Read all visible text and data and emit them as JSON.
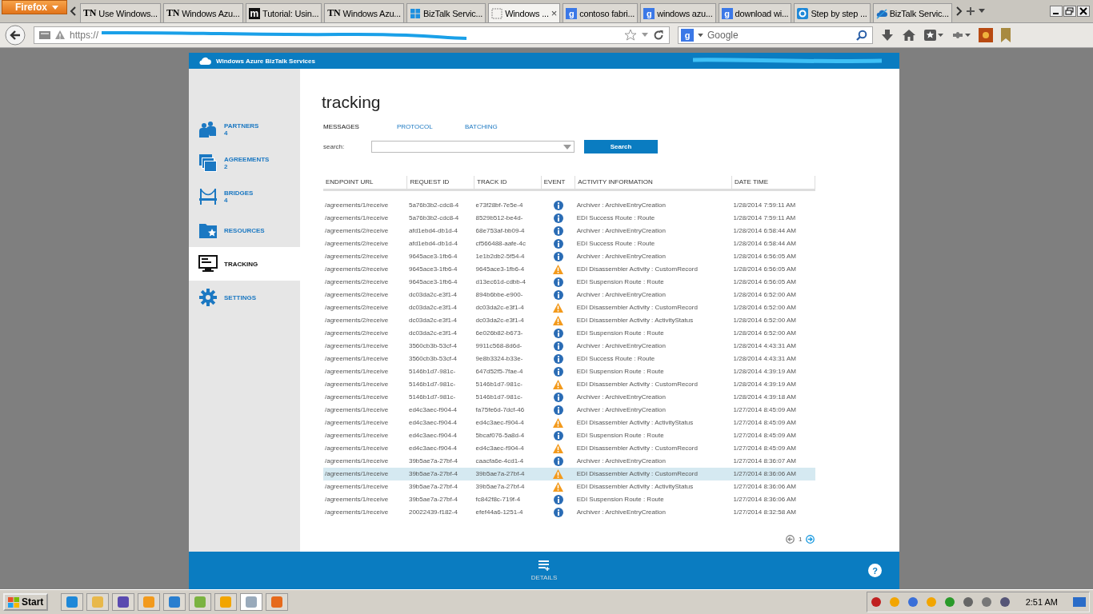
{
  "browser": {
    "menu_button": "Firefox",
    "tabs": [
      {
        "label": "Use Windows...",
        "kind": "text",
        "icon_text": "TN",
        "selected": false
      },
      {
        "label": "Windows Azu...",
        "kind": "text",
        "icon_text": "TN",
        "selected": false
      },
      {
        "label": "Tutorial: Usin...",
        "kind": "boxed",
        "icon_text": "m",
        "selected": false
      },
      {
        "label": "Windows Azu...",
        "kind": "text",
        "icon_text": "TN",
        "selected": false
      },
      {
        "label": "BizTalk Servic...",
        "kind": "windows",
        "selected": false
      },
      {
        "label": "Windows ...",
        "kind": "blank",
        "selected": true,
        "close": "×"
      },
      {
        "label": "contoso fabri...",
        "kind": "google",
        "icon_text": "g",
        "selected": false
      },
      {
        "label": "windows azu...",
        "kind": "google",
        "icon_text": "g",
        "selected": false
      },
      {
        "label": "download wi...",
        "kind": "google",
        "icon_text": "g",
        "selected": false
      },
      {
        "label": "Step by step ...",
        "kind": "ring",
        "selected": false
      },
      {
        "label": "BizTalk Servic...",
        "kind": "cloud",
        "selected": false
      }
    ],
    "url": "https://",
    "search": {
      "engine_letter": "g",
      "placeholder": "Google"
    }
  },
  "app": {
    "brand": "Windows Azure BizTalk Services",
    "sidebar": [
      {
        "kind": "partners",
        "label": "PARTNERS",
        "count": "4",
        "selected": false
      },
      {
        "kind": "agreements",
        "label": "AGREEMENTS",
        "count": "2",
        "selected": false
      },
      {
        "kind": "bridges",
        "label": "BRIDGES",
        "count": "4",
        "selected": false
      },
      {
        "kind": "resources",
        "label": "RESOURCES",
        "selected": false
      },
      {
        "kind": "tracking",
        "label": "TRACKING",
        "selected": true
      },
      {
        "kind": "settings",
        "label": "SETTINGS",
        "selected": false
      }
    ],
    "title": "tracking",
    "tabs": [
      {
        "label": "MESSAGES",
        "selected": true
      },
      {
        "label": "PROTOCOL",
        "selected": false
      },
      {
        "label": "BATCHING",
        "selected": false
      }
    ],
    "search_label": "search:",
    "search_button": "Search",
    "columns": [
      "ENDPOINT URL",
      "REQUEST ID",
      "TRACK ID",
      "EVENT",
      "ACTIVITY INFORMATION",
      "DATE TIME"
    ],
    "rows": [
      {
        "endpoint": "/agreements/1/receive",
        "request_id": "5a76b3b2-cdc8-4",
        "track_id": "e73f28bf-7e5e-4",
        "kind": "info",
        "activity": "Archiver : ArchiveEntryCreation",
        "datetime": "1/28/2014 7:59:11 AM",
        "selected": false
      },
      {
        "endpoint": "/agreements/1/receive",
        "request_id": "5a76b3b2-cdc8-4",
        "track_id": "8529b512-be4d-",
        "kind": "info",
        "activity": "EDI Success Route : Route",
        "datetime": "1/28/2014 7:59:11 AM",
        "selected": false
      },
      {
        "endpoint": "/agreements/2/receive",
        "request_id": "afd1ebd4-db1d-4",
        "track_id": "68e753af-bb09-4",
        "kind": "info",
        "activity": "Archiver : ArchiveEntryCreation",
        "datetime": "1/28/2014 6:58:44 AM",
        "selected": false
      },
      {
        "endpoint": "/agreements/2/receive",
        "request_id": "afd1ebd4-db1d-4",
        "track_id": "cf566488-aafe-4c",
        "kind": "info",
        "activity": "EDI Success Route : Route",
        "datetime": "1/28/2014 6:58:44 AM",
        "selected": false
      },
      {
        "endpoint": "/agreements/2/receive",
        "request_id": "9645ace3-1fb6-4",
        "track_id": "1e1b2db2-5f54-4",
        "kind": "info",
        "activity": "Archiver : ArchiveEntryCreation",
        "datetime": "1/28/2014 6:56:05 AM",
        "selected": false
      },
      {
        "endpoint": "/agreements/2/receive",
        "request_id": "9645ace3-1fb6-4",
        "track_id": "9645ace3-1fb6-4",
        "kind": "warning",
        "activity": "EDI Disassembler Activity : CustomRecord",
        "datetime": "1/28/2014 6:56:05 AM",
        "selected": false
      },
      {
        "endpoint": "/agreements/2/receive",
        "request_id": "9645ace3-1fb6-4",
        "track_id": "d13ec61d-cdbb-4",
        "kind": "info",
        "activity": "EDI Suspension Route : Route",
        "datetime": "1/28/2014 6:56:05 AM",
        "selected": false
      },
      {
        "endpoint": "/agreements/2/receive",
        "request_id": "dc03da2c-e3f1-4",
        "track_id": "894b6bbe-e900-",
        "kind": "info",
        "activity": "Archiver : ArchiveEntryCreation",
        "datetime": "1/28/2014 6:52:00 AM",
        "selected": false
      },
      {
        "endpoint": "/agreements/2/receive",
        "request_id": "dc03da2c-e3f1-4",
        "track_id": "dc03da2c-e3f1-4",
        "kind": "warning",
        "activity": "EDI Disassembler Activity : CustomRecord",
        "datetime": "1/28/2014 6:52:00 AM",
        "selected": false
      },
      {
        "endpoint": "/agreements/2/receive",
        "request_id": "dc03da2c-e3f1-4",
        "track_id": "dc03da2c-e3f1-4",
        "kind": "warning",
        "activity": "EDI Disassembler Activity : ActivityStatus",
        "datetime": "1/28/2014 6:52:00 AM",
        "selected": false
      },
      {
        "endpoint": "/agreements/2/receive",
        "request_id": "dc03da2c-e3f1-4",
        "track_id": "6e026b82-b673-",
        "kind": "info",
        "activity": "EDI Suspension Route : Route",
        "datetime": "1/28/2014 6:52:00 AM",
        "selected": false
      },
      {
        "endpoint": "/agreements/1/receive",
        "request_id": "3560cb3b-53cf-4",
        "track_id": "9911c568-8d6d-",
        "kind": "info",
        "activity": "Archiver : ArchiveEntryCreation",
        "datetime": "1/28/2014 4:43:31 AM",
        "selected": false
      },
      {
        "endpoint": "/agreements/1/receive",
        "request_id": "3560cb3b-53cf-4",
        "track_id": "9e8b3324-b33e-",
        "kind": "info",
        "activity": "EDI Success Route : Route",
        "datetime": "1/28/2014 4:43:31 AM",
        "selected": false
      },
      {
        "endpoint": "/agreements/1/receive",
        "request_id": "5146b1d7-981c-",
        "track_id": "647d52f5-7fae-4",
        "kind": "info",
        "activity": "EDI Suspension Route : Route",
        "datetime": "1/28/2014 4:39:19 AM",
        "selected": false
      },
      {
        "endpoint": "/agreements/1/receive",
        "request_id": "5146b1d7-981c-",
        "track_id": "5146b1d7-981c-",
        "kind": "warning",
        "activity": "EDI Disassembler Activity : CustomRecord",
        "datetime": "1/28/2014 4:39:19 AM",
        "selected": false
      },
      {
        "endpoint": "/agreements/1/receive",
        "request_id": "5146b1d7-981c-",
        "track_id": "5146b1d7-981c-",
        "kind": "info",
        "activity": "Archiver : ArchiveEntryCreation",
        "datetime": "1/28/2014 4:39:18 AM",
        "selected": false
      },
      {
        "endpoint": "/agreements/1/receive",
        "request_id": "ed4c3aec-f904-4",
        "track_id": "fa75fe6d-7dcf-46",
        "kind": "info",
        "activity": "Archiver : ArchiveEntryCreation",
        "datetime": "1/27/2014 8:45:09 AM",
        "selected": false
      },
      {
        "endpoint": "/agreements/1/receive",
        "request_id": "ed4c3aec-f904-4",
        "track_id": "ed4c3aec-f904-4",
        "kind": "warning",
        "activity": "EDI Disassembler Activity : ActivityStatus",
        "datetime": "1/27/2014 8:45:09 AM",
        "selected": false
      },
      {
        "endpoint": "/agreements/1/receive",
        "request_id": "ed4c3aec-f904-4",
        "track_id": "5bcaf076-5a8d-4",
        "kind": "info",
        "activity": "EDI Suspension Route : Route",
        "datetime": "1/27/2014 8:45:09 AM",
        "selected": false
      },
      {
        "endpoint": "/agreements/1/receive",
        "request_id": "ed4c3aec-f904-4",
        "track_id": "ed4c3aec-f904-4",
        "kind": "warning",
        "activity": "EDI Disassembler Activity : CustomRecord",
        "datetime": "1/27/2014 8:45:09 AM",
        "selected": false
      },
      {
        "endpoint": "/agreements/1/receive",
        "request_id": "39b5ae7a-27bf-4",
        "track_id": "caacfa6e-4cd1-4",
        "kind": "info",
        "activity": "Archiver : ArchiveEntryCreation",
        "datetime": "1/27/2014 8:36:07 AM",
        "selected": false
      },
      {
        "endpoint": "/agreements/1/receive",
        "request_id": "39b5ae7a-27bf-4",
        "track_id": "39b5ae7a-27bf-4",
        "kind": "warning",
        "activity": "EDI Disassembler Activity : CustomRecord",
        "datetime": "1/27/2014 8:36:06 AM",
        "selected": true
      },
      {
        "endpoint": "/agreements/1/receive",
        "request_id": "39b5ae7a-27bf-4",
        "track_id": "39b5ae7a-27bf-4",
        "kind": "warning",
        "activity": "EDI Disassembler Activity : ActivityStatus",
        "datetime": "1/27/2014 8:36:06 AM",
        "selected": false
      },
      {
        "endpoint": "/agreements/1/receive",
        "request_id": "39b5ae7a-27bf-4",
        "track_id": "fc842f8c-719f-4",
        "kind": "info",
        "activity": "EDI Suspension Route : Route",
        "datetime": "1/27/2014 8:36:06 AM",
        "selected": false
      },
      {
        "endpoint": "/agreements/1/receive",
        "request_id": "20022439-f182-4",
        "track_id": "efef44a6-1251-4",
        "kind": "info",
        "activity": "Archiver : ArchiveEntryCreation",
        "datetime": "1/27/2014 8:32:58 AM",
        "selected": false
      }
    ],
    "page": "1",
    "footer": {
      "details": "DETAILS",
      "help": "?"
    }
  },
  "taskbar": {
    "start": "Start",
    "clock": "2:51 AM"
  }
}
